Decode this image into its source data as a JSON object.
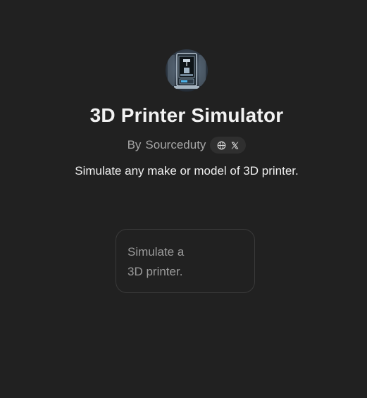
{
  "gpt": {
    "name": "3D Printer Simulator",
    "by_prefix": "By",
    "author": "Sourceduty",
    "description": "Simulate any make or model of 3D printer.",
    "avatar_icon": "3d-printer-avatar",
    "social_icons": [
      "globe-icon",
      "x-logo-icon"
    ]
  },
  "starters": [
    {
      "line1": "Simulate a",
      "line2": "3D printer."
    }
  ],
  "colors": {
    "background": "#212121",
    "title": "#f2f2f2",
    "muted": "#a6a6a6",
    "card_border": "#3a3a3a",
    "card_text": "#9b9b9b",
    "pill_bg": "#2f2f2f"
  }
}
